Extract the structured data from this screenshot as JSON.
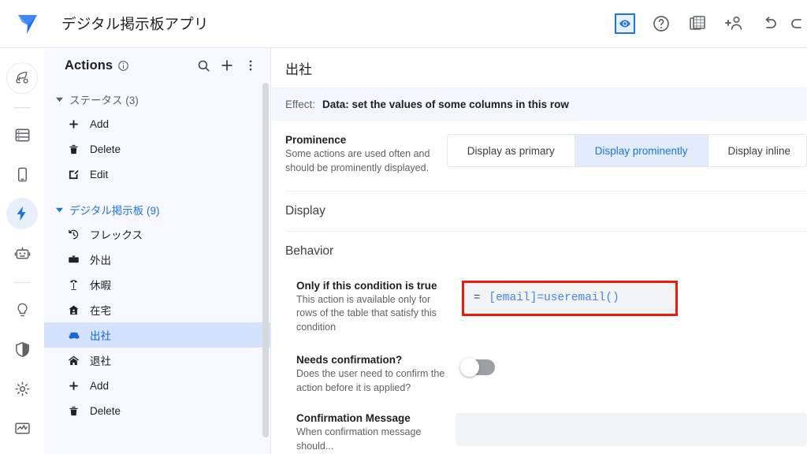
{
  "header": {
    "app_title": "デジタル掲示板アプリ",
    "logo_icon": "appsheet-logo-icon",
    "actions": [
      {
        "name": "preview-eye-icon",
        "label": "Preview",
        "active": true
      },
      {
        "name": "help-circle-icon",
        "label": "Help",
        "active": false
      },
      {
        "name": "table-data-icon",
        "label": "Data tables",
        "active": false
      },
      {
        "name": "add-person-icon",
        "label": "Share app",
        "active": false
      },
      {
        "name": "undo-icon",
        "label": "Undo",
        "active": false
      },
      {
        "name": "redo-icon",
        "label": "Redo",
        "active": false
      }
    ]
  },
  "rail": {
    "items": [
      {
        "name": "rail-item-deploy",
        "icon": "rocket-icon",
        "selected": false,
        "ring": true
      },
      {
        "name": "rail-item-data",
        "icon": "database-list-icon",
        "selected": false
      },
      {
        "name": "rail-item-app",
        "icon": "mobile-device-icon",
        "selected": false
      },
      {
        "name": "rail-item-automation",
        "icon": "lightning-bolt-icon",
        "selected": true
      },
      {
        "name": "rail-item-bots",
        "icon": "robot-icon",
        "selected": false
      },
      {
        "name": "rail-item-intelligence",
        "icon": "lightbulb-icon",
        "selected": false
      },
      {
        "name": "rail-item-security",
        "icon": "shield-icon",
        "selected": false
      },
      {
        "name": "rail-item-settings",
        "icon": "gear-icon",
        "selected": false
      },
      {
        "name": "rail-item-monitor",
        "icon": "monitor-chart-icon",
        "selected": false
      }
    ]
  },
  "panel": {
    "title": "Actions",
    "info_icon": "info-circle-icon",
    "head_actions": [
      {
        "name": "search-icon",
        "label": "Search"
      },
      {
        "name": "plus-icon",
        "label": "Add action"
      },
      {
        "name": "more-vert-icon",
        "label": "More options"
      }
    ],
    "groups": [
      {
        "name": "group-status",
        "label": "ステータス (3)",
        "active": false,
        "items": [
          {
            "name": "action-add",
            "label": "Add",
            "icon": "plus-icon",
            "selected": false
          },
          {
            "name": "action-delete",
            "label": "Delete",
            "icon": "trash-icon",
            "selected": false
          },
          {
            "name": "action-edit",
            "label": "Edit",
            "icon": "edit-square-icon",
            "selected": false
          }
        ]
      },
      {
        "name": "group-digital-board",
        "label": "デジタル掲示板 (9)",
        "active": true,
        "items": [
          {
            "name": "action-flex",
            "label": "フレックス",
            "icon": "history-icon",
            "selected": false
          },
          {
            "name": "action-gaishutsu",
            "label": "外出",
            "icon": "briefcase-icon",
            "selected": false
          },
          {
            "name": "action-kyuka",
            "label": "休暇",
            "icon": "beach-umbrella-icon",
            "selected": false
          },
          {
            "name": "action-zaitaku",
            "label": "在宅",
            "icon": "home-person-icon",
            "selected": false
          },
          {
            "name": "action-shussha",
            "label": "出社",
            "icon": "car-icon",
            "selected": true
          },
          {
            "name": "action-taisha",
            "label": "退社",
            "icon": "house-icon",
            "selected": false
          },
          {
            "name": "action-add-2",
            "label": "Add",
            "icon": "plus-icon",
            "selected": false
          },
          {
            "name": "action-delete-2",
            "label": "Delete",
            "icon": "trash-icon",
            "selected": false
          }
        ]
      }
    ]
  },
  "main": {
    "title": "出社",
    "effect_label": "Effect:",
    "effect_value": "Data: set the values of some columns in this row",
    "prominence": {
      "name": "Prominence",
      "desc": "Some actions are used often and should be prominently displayed.",
      "options": [
        {
          "label": "Display as primary",
          "selected": false
        },
        {
          "label": "Display prominently",
          "selected": true
        },
        {
          "label": "Display inline",
          "selected": false
        }
      ]
    },
    "display_section_title": "Display",
    "behavior_section_title": "Behavior",
    "condition": {
      "name": "Only if this condition is true",
      "desc": "This action is available only for rows of the table that satisfy this condition",
      "equals_sign": "=",
      "formula": "[email]=useremail()",
      "highlight_color": "#ea1c0d"
    },
    "needs_confirmation": {
      "name": "Needs confirmation?",
      "desc": "Does the user need to confirm the action before it is applied?",
      "value": false
    },
    "confirmation_message": {
      "name": "Confirmation Message",
      "value": "",
      "placeholder": ""
    }
  },
  "colors": {
    "accent": "#1a73e8",
    "selected_row_bg": "#d3e3fd",
    "panel_bg": "#f7f9fe",
    "effect_bar_bg": "#f3f6fd",
    "error_outline": "#ea1c0d"
  }
}
